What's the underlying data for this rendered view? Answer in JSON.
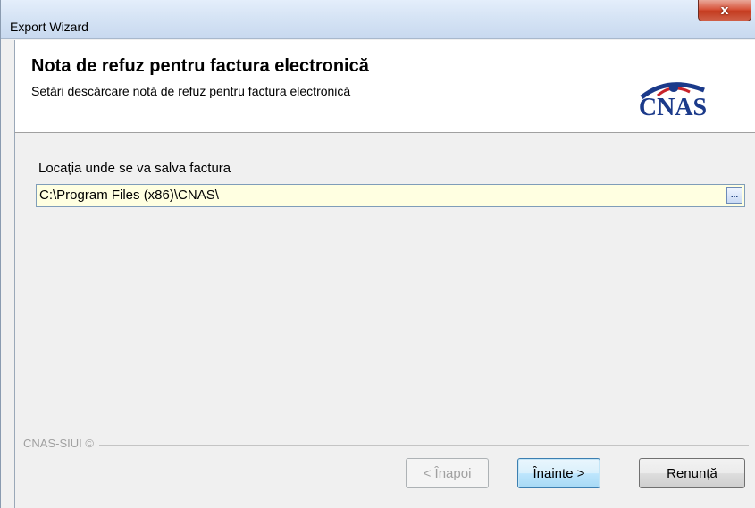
{
  "window": {
    "title": "Export Wizard",
    "close_glyph": "x"
  },
  "header": {
    "title": "Nota de refuz pentru factura electronică",
    "subtitle": "Setări descărcare notă de refuz pentru factura electronică",
    "logo_text": "CNAS",
    "logo_color": "#1b3a8a"
  },
  "form": {
    "location_label": "Locația unde se va salva factura",
    "location_value": "C:\\Program Files (x86)\\CNAS\\",
    "browse_label": "..."
  },
  "footer": {
    "brand": "CNAS-SIUI ©"
  },
  "buttons": {
    "back": {
      "prefix": "< ",
      "label": "Înapoi",
      "enabled": false
    },
    "next": {
      "label": "Înainte ",
      "suffix": ">"
    },
    "cancel": {
      "prefix": "R",
      "label": "enunță"
    }
  }
}
